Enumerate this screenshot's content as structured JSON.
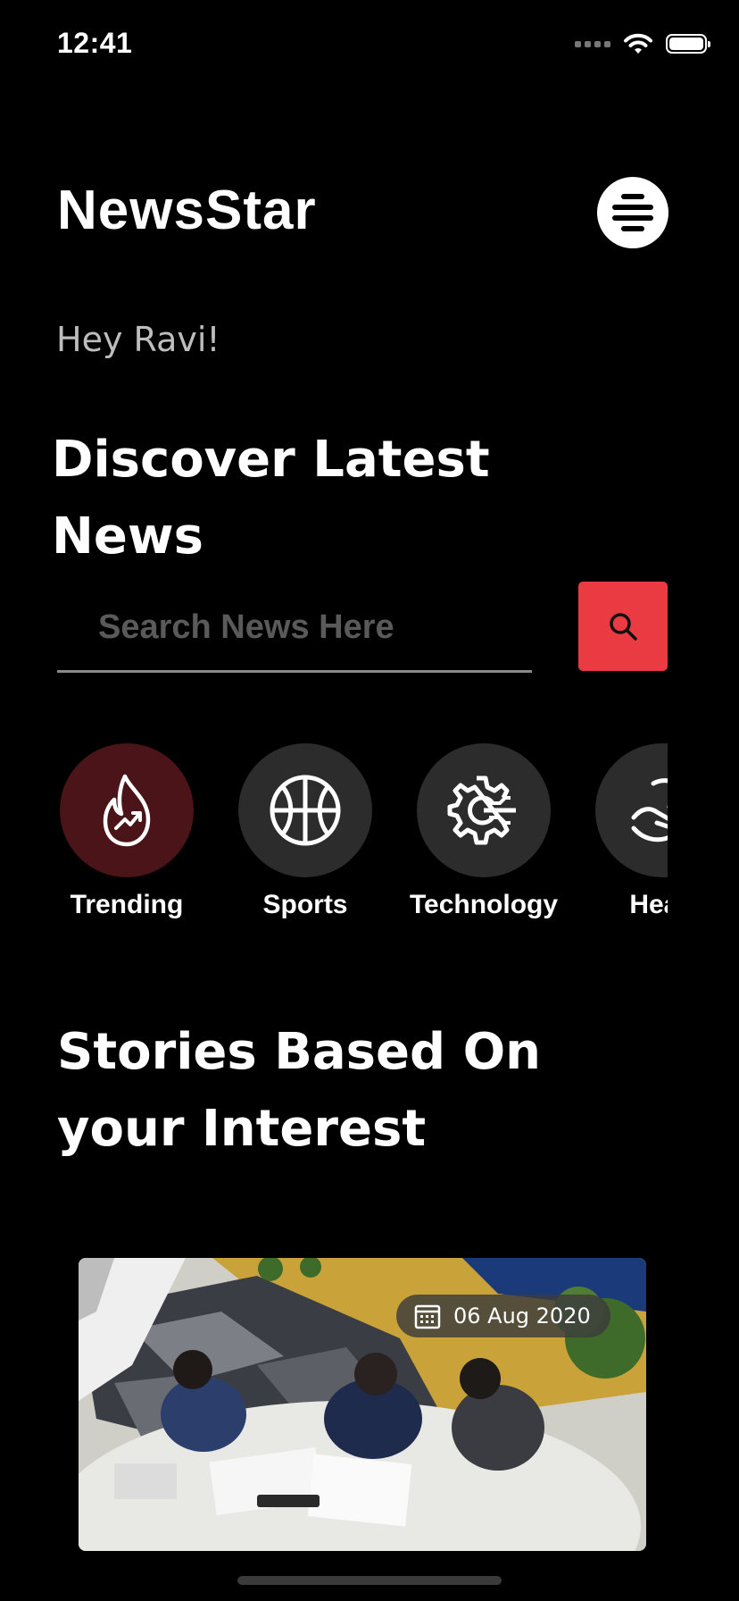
{
  "status_bar": {
    "time": "12:41"
  },
  "header": {
    "app_title": "NewsStar",
    "menu_icon": "menu-lines-icon"
  },
  "greeting": "Hey Ravi!",
  "headline": "Discover Latest News",
  "search": {
    "placeholder": "Search News Here",
    "value": "",
    "button_icon": "search-icon"
  },
  "categories": [
    {
      "label": "Trending",
      "icon": "trending-flame-icon",
      "active": true
    },
    {
      "label": "Sports",
      "icon": "basketball-icon",
      "active": false
    },
    {
      "label": "Technology",
      "icon": "gear-circuit-icon",
      "active": false
    },
    {
      "label": "Healt",
      "icon": "health-hand-icon",
      "active": false
    }
  ],
  "section_title": "Stories Based On your Interest",
  "stories": [
    {
      "date": "06 Aug 2020",
      "date_icon": "calendar-icon"
    }
  ],
  "colors": {
    "background": "#000000",
    "accent": "#ea3b43",
    "active_category": "#4a1418",
    "category_bg": "#2c2c2c"
  }
}
